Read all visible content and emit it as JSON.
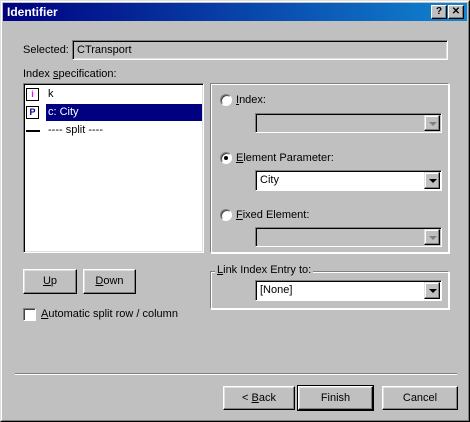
{
  "window": {
    "title": "Identifier",
    "help_glyph": "?",
    "close_glyph": "✕"
  },
  "selected": {
    "label": "Selected:",
    "value": "CTransport"
  },
  "index_spec": {
    "label": "Index specification:",
    "items": [
      {
        "icon": "i",
        "text": "k",
        "selected": false
      },
      {
        "icon": "P",
        "text": "c: City",
        "selected": true
      },
      {
        "icon": "line",
        "text": "---- split ----",
        "selected": false
      }
    ]
  },
  "options": {
    "index": {
      "label": "Index:",
      "value": "",
      "checked": false
    },
    "element_parameter": {
      "label": "Element Parameter:",
      "value": "City",
      "checked": true
    },
    "fixed_element": {
      "label": "Fixed Element:",
      "value": "",
      "checked": false
    }
  },
  "link_index": {
    "label": "Link Index Entry to:",
    "value": "[None]"
  },
  "buttons": {
    "up": "Up",
    "down": "Down",
    "back": "< Back",
    "finish": "Finish",
    "cancel": "Cancel"
  },
  "auto_split": {
    "label": "Automatic split row / column",
    "checked": false
  },
  "colors": {
    "title_bar": "#000080",
    "selection": "#000080",
    "icon_i": "#ff00ff",
    "dialog_bg": "#c0c0c0"
  }
}
